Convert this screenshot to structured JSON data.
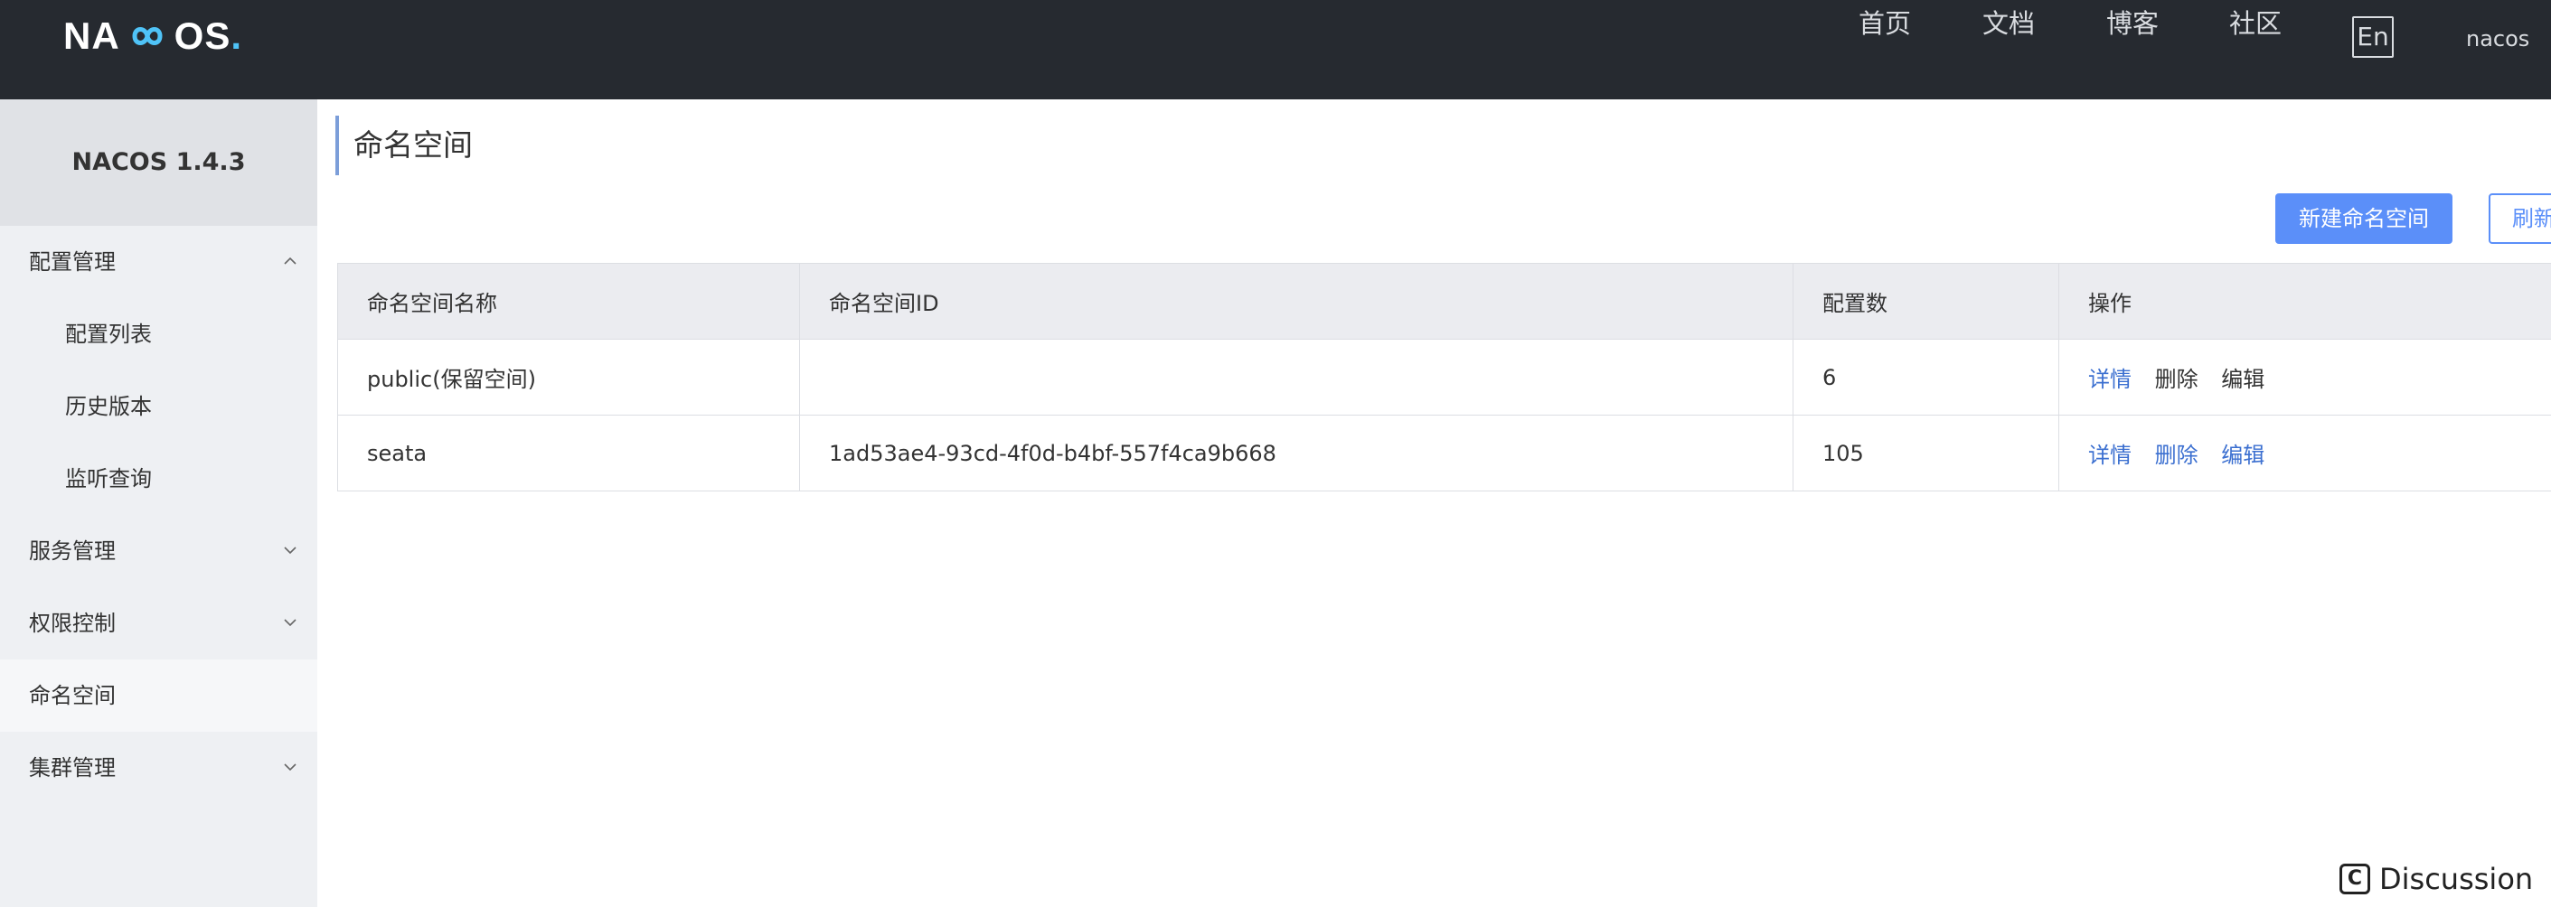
{
  "header": {
    "logo_prefix": "NA",
    "logo_suffix": "OS",
    "logo_dot": ".",
    "nav": [
      "首页",
      "文档",
      "博客",
      "社区"
    ],
    "lang": "En",
    "user": "nacos"
  },
  "sidebar": {
    "title": "NACOS 1.4.3",
    "items": [
      {
        "label": "配置管理"
      },
      {
        "label": "配置列表"
      },
      {
        "label": "历史版本"
      },
      {
        "label": "监听查询"
      },
      {
        "label": "服务管理"
      },
      {
        "label": "权限控制"
      },
      {
        "label": "命名空间"
      },
      {
        "label": "集群管理"
      }
    ]
  },
  "main": {
    "title": "命名空间",
    "create_button": "新建命名空间",
    "refresh_button": "刷新",
    "table": {
      "headers": [
        "命名空间名称",
        "命名空间ID",
        "配置数",
        "操作"
      ],
      "rows": [
        {
          "name": "public(保留空间)",
          "id": "",
          "count": "6",
          "ops": [
            "详情",
            "删除",
            "编辑"
          ]
        },
        {
          "name": "seata",
          "id": "1ad53ae4-93cd-4f0d-b4bf-557f4ca9b668",
          "count": "105",
          "ops": [
            "详情",
            "删除",
            "编辑"
          ]
        }
      ]
    }
  },
  "footer": {
    "discussion_icon": "C",
    "discussion_label": "Discussion"
  },
  "colors": {
    "header_bg": "#262a30",
    "sidebar_bg": "#eef0f3",
    "primary": "#5b8ff9",
    "link": "#3b6fd0"
  }
}
